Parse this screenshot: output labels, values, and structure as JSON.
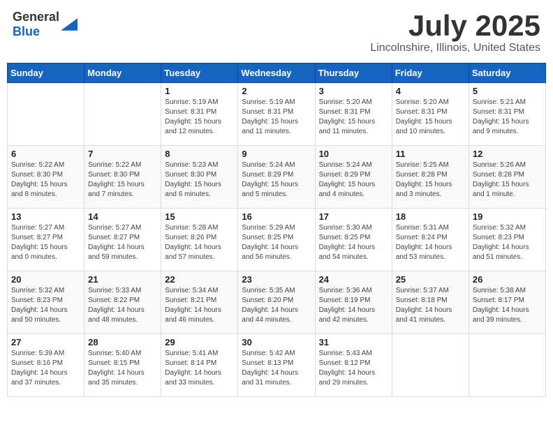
{
  "header": {
    "logo_general": "General",
    "logo_blue": "Blue",
    "main_title": "July 2025",
    "subtitle": "Lincolnshire, Illinois, United States"
  },
  "weekdays": [
    "Sunday",
    "Monday",
    "Tuesday",
    "Wednesday",
    "Thursday",
    "Friday",
    "Saturday"
  ],
  "weeks": [
    [
      {
        "day": "",
        "info": ""
      },
      {
        "day": "",
        "info": ""
      },
      {
        "day": "1",
        "info": "Sunrise: 5:19 AM\nSunset: 8:31 PM\nDaylight: 15 hours and 12 minutes."
      },
      {
        "day": "2",
        "info": "Sunrise: 5:19 AM\nSunset: 8:31 PM\nDaylight: 15 hours and 11 minutes."
      },
      {
        "day": "3",
        "info": "Sunrise: 5:20 AM\nSunset: 8:31 PM\nDaylight: 15 hours and 11 minutes."
      },
      {
        "day": "4",
        "info": "Sunrise: 5:20 AM\nSunset: 8:31 PM\nDaylight: 15 hours and 10 minutes."
      },
      {
        "day": "5",
        "info": "Sunrise: 5:21 AM\nSunset: 8:31 PM\nDaylight: 15 hours and 9 minutes."
      }
    ],
    [
      {
        "day": "6",
        "info": "Sunrise: 5:22 AM\nSunset: 8:30 PM\nDaylight: 15 hours and 8 minutes."
      },
      {
        "day": "7",
        "info": "Sunrise: 5:22 AM\nSunset: 8:30 PM\nDaylight: 15 hours and 7 minutes."
      },
      {
        "day": "8",
        "info": "Sunrise: 5:23 AM\nSunset: 8:30 PM\nDaylight: 15 hours and 6 minutes."
      },
      {
        "day": "9",
        "info": "Sunrise: 5:24 AM\nSunset: 8:29 PM\nDaylight: 15 hours and 5 minutes."
      },
      {
        "day": "10",
        "info": "Sunrise: 5:24 AM\nSunset: 8:29 PM\nDaylight: 15 hours and 4 minutes."
      },
      {
        "day": "11",
        "info": "Sunrise: 5:25 AM\nSunset: 8:28 PM\nDaylight: 15 hours and 3 minutes."
      },
      {
        "day": "12",
        "info": "Sunrise: 5:26 AM\nSunset: 8:28 PM\nDaylight: 15 hours and 1 minute."
      }
    ],
    [
      {
        "day": "13",
        "info": "Sunrise: 5:27 AM\nSunset: 8:27 PM\nDaylight: 15 hours and 0 minutes."
      },
      {
        "day": "14",
        "info": "Sunrise: 5:27 AM\nSunset: 8:27 PM\nDaylight: 14 hours and 59 minutes."
      },
      {
        "day": "15",
        "info": "Sunrise: 5:28 AM\nSunset: 8:26 PM\nDaylight: 14 hours and 57 minutes."
      },
      {
        "day": "16",
        "info": "Sunrise: 5:29 AM\nSunset: 8:25 PM\nDaylight: 14 hours and 56 minutes."
      },
      {
        "day": "17",
        "info": "Sunrise: 5:30 AM\nSunset: 8:25 PM\nDaylight: 14 hours and 54 minutes."
      },
      {
        "day": "18",
        "info": "Sunrise: 5:31 AM\nSunset: 8:24 PM\nDaylight: 14 hours and 53 minutes."
      },
      {
        "day": "19",
        "info": "Sunrise: 5:32 AM\nSunset: 8:23 PM\nDaylight: 14 hours and 51 minutes."
      }
    ],
    [
      {
        "day": "20",
        "info": "Sunrise: 5:32 AM\nSunset: 8:23 PM\nDaylight: 14 hours and 50 minutes."
      },
      {
        "day": "21",
        "info": "Sunrise: 5:33 AM\nSunset: 8:22 PM\nDaylight: 14 hours and 48 minutes."
      },
      {
        "day": "22",
        "info": "Sunrise: 5:34 AM\nSunset: 8:21 PM\nDaylight: 14 hours and 46 minutes."
      },
      {
        "day": "23",
        "info": "Sunrise: 5:35 AM\nSunset: 8:20 PM\nDaylight: 14 hours and 44 minutes."
      },
      {
        "day": "24",
        "info": "Sunrise: 5:36 AM\nSunset: 8:19 PM\nDaylight: 14 hours and 42 minutes."
      },
      {
        "day": "25",
        "info": "Sunrise: 5:37 AM\nSunset: 8:18 PM\nDaylight: 14 hours and 41 minutes."
      },
      {
        "day": "26",
        "info": "Sunrise: 5:38 AM\nSunset: 8:17 PM\nDaylight: 14 hours and 39 minutes."
      }
    ],
    [
      {
        "day": "27",
        "info": "Sunrise: 5:39 AM\nSunset: 8:16 PM\nDaylight: 14 hours and 37 minutes."
      },
      {
        "day": "28",
        "info": "Sunrise: 5:40 AM\nSunset: 8:15 PM\nDaylight: 14 hours and 35 minutes."
      },
      {
        "day": "29",
        "info": "Sunrise: 5:41 AM\nSunset: 8:14 PM\nDaylight: 14 hours and 33 minutes."
      },
      {
        "day": "30",
        "info": "Sunrise: 5:42 AM\nSunset: 8:13 PM\nDaylight: 14 hours and 31 minutes."
      },
      {
        "day": "31",
        "info": "Sunrise: 5:43 AM\nSunset: 8:12 PM\nDaylight: 14 hours and 29 minutes."
      },
      {
        "day": "",
        "info": ""
      },
      {
        "day": "",
        "info": ""
      }
    ]
  ]
}
